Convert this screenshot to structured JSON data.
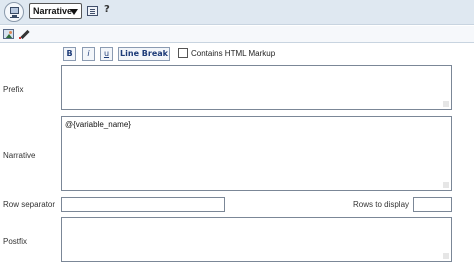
{
  "header": {
    "view_icon": "view-monitor-icon",
    "view_select": {
      "selected": "Narrative"
    },
    "properties_icon": "properties-icon",
    "help_icon": "help-icon",
    "help_glyph": "?"
  },
  "toolbar": {
    "image_icon": "insert-image-icon",
    "edit_icon": "edit-pencil-icon"
  },
  "format_buttons": {
    "bold": "B",
    "italic": "i",
    "underline": "u",
    "line_break": "Line Break"
  },
  "options": {
    "contains_html_label": "Contains HTML Markup",
    "contains_html_checked": false
  },
  "fields": {
    "prefix_label": "Prefix",
    "prefix_value": "",
    "narrative_label": "Narrative",
    "narrative_value": "@{variable_name}",
    "row_separator_label": "Row separator",
    "row_separator_value": "",
    "rows_to_display_label": "Rows to display",
    "rows_to_display_value": "",
    "postfix_label": "Postfix",
    "postfix_value": ""
  }
}
